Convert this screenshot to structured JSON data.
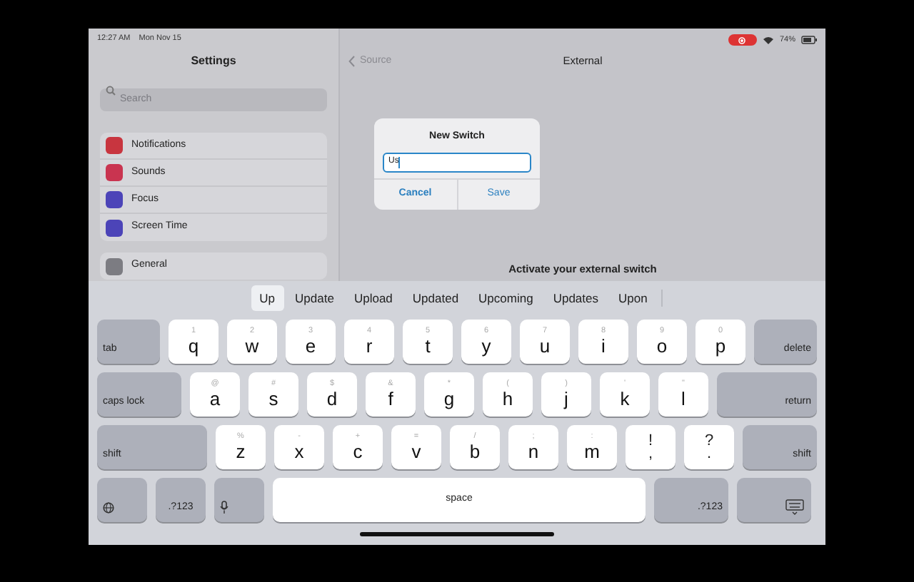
{
  "status_bar": {
    "time": "12:27 AM",
    "date": "Mon Nov 15",
    "battery": "74%",
    "recording": true
  },
  "sidebar": {
    "title": "Settings",
    "search": {
      "placeholder": "Search"
    },
    "groups": [
      [
        {
          "label": "Notifications",
          "color": "#c8353f"
        },
        {
          "label": "Sounds",
          "color": "#c93450"
        },
        {
          "label": "Focus",
          "color": "#4c44b8"
        },
        {
          "label": "Screen Time",
          "color": "#4c44b8"
        }
      ],
      [
        {
          "label": "General",
          "color": "#7c7c82"
        }
      ]
    ]
  },
  "main": {
    "back": "Source",
    "title": "External",
    "footer": "Activate your external switch"
  },
  "dialog": {
    "title": "New Switch",
    "value": "Us",
    "buttons": [
      "Cancel",
      "Save"
    ]
  },
  "keyboard": {
    "suggestions": [
      {
        "label": "Up",
        "selected": true
      },
      {
        "label": "Update",
        "selected": false
      },
      {
        "label": "Upload",
        "selected": false
      },
      {
        "label": "Updated",
        "selected": false
      },
      {
        "label": "Upcoming",
        "selected": false
      },
      {
        "label": "Updates",
        "selected": false
      },
      {
        "label": "Upon",
        "selected": false
      }
    ],
    "rows": [
      [
        {
          "kind": "left",
          "label": "tab"
        },
        {
          "kind": "letter",
          "label": "q",
          "hint": "1"
        },
        {
          "kind": "letter",
          "label": "w",
          "hint": "2"
        },
        {
          "kind": "letter",
          "label": "e",
          "hint": "3"
        },
        {
          "kind": "letter",
          "label": "r",
          "hint": "4"
        },
        {
          "kind": "letter",
          "label": "t",
          "hint": "5"
        },
        {
          "kind": "letter",
          "label": "y",
          "hint": "6"
        },
        {
          "kind": "letter",
          "label": "u",
          "hint": "7"
        },
        {
          "kind": "letter",
          "label": "i",
          "hint": "8"
        },
        {
          "kind": "letter",
          "label": "o",
          "hint": "9"
        },
        {
          "kind": "letter",
          "label": "p",
          "hint": "0"
        },
        {
          "kind": "right",
          "label": "delete"
        }
      ],
      [
        {
          "kind": "left",
          "label": "caps lock"
        },
        {
          "kind": "letter",
          "label": "a",
          "hint": "@"
        },
        {
          "kind": "letter",
          "label": "s",
          "hint": "#"
        },
        {
          "kind": "letter",
          "label": "d",
          "hint": "$"
        },
        {
          "kind": "letter",
          "label": "f",
          "hint": "&"
        },
        {
          "kind": "letter",
          "label": "g",
          "hint": "*"
        },
        {
          "kind": "letter",
          "label": "h",
          "hint": "("
        },
        {
          "kind": "letter",
          "label": "j",
          "hint": ")"
        },
        {
          "kind": "letter",
          "label": "k",
          "hint": "'"
        },
        {
          "kind": "letter",
          "label": "l",
          "hint": "\""
        },
        {
          "kind": "right",
          "label": "return"
        }
      ],
      [
        {
          "kind": "left",
          "label": "shift"
        },
        {
          "kind": "letter",
          "label": "z",
          "hint": "%"
        },
        {
          "kind": "letter",
          "label": "x",
          "hint": "-"
        },
        {
          "kind": "letter",
          "label": "c",
          "hint": "+"
        },
        {
          "kind": "letter",
          "label": "v",
          "hint": "="
        },
        {
          "kind": "letter",
          "label": "b",
          "hint": "/"
        },
        {
          "kind": "letter",
          "label": "n",
          "hint": ";"
        },
        {
          "kind": "letter",
          "label": "m",
          "hint": ":"
        },
        {
          "kind": "pair",
          "label": ",",
          "hint": "!"
        },
        {
          "kind": "pair",
          "label": ".",
          "hint": "?"
        },
        {
          "kind": "right",
          "label": "shift"
        }
      ],
      [
        {
          "kind": "globe"
        },
        {
          "kind": "left",
          "label": ".?123"
        },
        {
          "kind": "dictation"
        },
        {
          "kind": "space",
          "label": "space"
        },
        {
          "kind": "right",
          "label": ".?123"
        },
        {
          "kind": "dismiss"
        }
      ]
    ]
  }
}
